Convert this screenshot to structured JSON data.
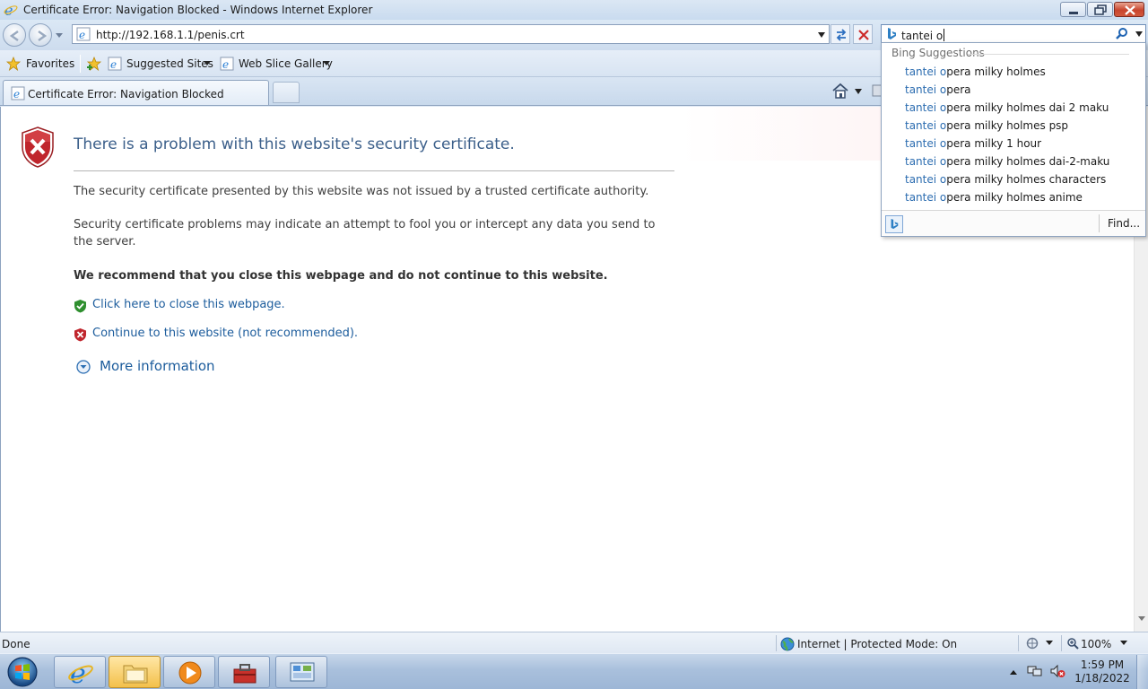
{
  "window": {
    "title": "Certificate Error: Navigation Blocked - Windows Internet Explorer",
    "controls": [
      "minimize-icon",
      "restore-icon",
      "close-icon"
    ]
  },
  "toolbar": {
    "address": "http://192.168.1.1/penis.crt",
    "search_value": "tantei o",
    "icons": [
      "back-icon",
      "forward-icon",
      "recent-pages-icon",
      "ie-page-icon",
      "compatibility-view-icon",
      "stop-icon",
      "bing-icon",
      "search-icon"
    ]
  },
  "favorites": {
    "favorites_label": "Favorites",
    "suggested_sites": "Suggested Sites",
    "web_slice_gallery": "Web Slice Gallery"
  },
  "tab": {
    "title": "Certificate Error: Navigation Blocked"
  },
  "error_page": {
    "heading": "There is a problem with this website's security certificate.",
    "para1": "The security certificate presented by this website was not issued by a trusted certificate authority.",
    "para2": "Security certificate problems may indicate an attempt to fool you or intercept any data you send to the server.",
    "recommendation": "We recommend that you close this webpage and do not continue to this website.",
    "close_link": "Click here to close this webpage.",
    "continue_link": "Continue to this website (not recommended).",
    "more_info": "More information"
  },
  "suggestions": {
    "header": "Bing Suggestions",
    "items": [
      {
        "match": "tantei o",
        "rest": "pera milky holmes"
      },
      {
        "match": "tantei o",
        "rest": "pera"
      },
      {
        "match": "tantei o",
        "rest": "pera milky holmes dai 2 maku"
      },
      {
        "match": "tantei o",
        "rest": "pera milky holmes psp"
      },
      {
        "match": "tantei o",
        "rest": "pera milky 1 hour"
      },
      {
        "match": "tantei o",
        "rest": "pera milky holmes dai-2-maku"
      },
      {
        "match": "tantei o",
        "rest": "pera milky holmes characters"
      },
      {
        "match": "tantei o",
        "rest": "pera milky holmes anime"
      }
    ],
    "find_label": "Find..."
  },
  "status": {
    "text": "Done",
    "zone": "Internet | Protected Mode: On",
    "zoom": "100%"
  },
  "taskbar": {
    "time": "1:59 PM",
    "date": "1/18/2022",
    "apps": [
      "internet-explorer",
      "windows-explorer",
      "windows-media-player",
      "toolbox",
      "control-panel"
    ]
  },
  "colors": {
    "link": "#1c5c9c",
    "heading": "#3b5f8a",
    "suggest_highlight": "#2b6cb0",
    "shield_red": "#c0262d",
    "shield_green": "#2f8f2f"
  }
}
